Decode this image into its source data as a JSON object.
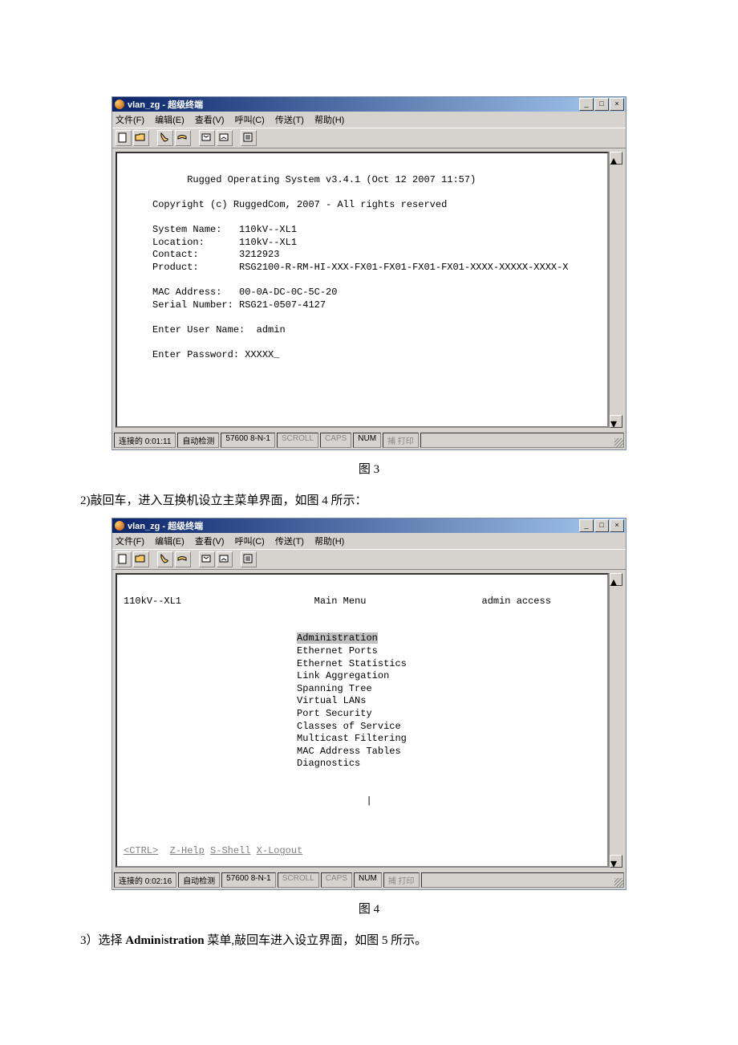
{
  "window1": {
    "title": "vlan_zg - 超级终端",
    "menu": {
      "file": "文件(F)",
      "edit": "编辑(E)",
      "view": "查看(V)",
      "call": "呼叫(C)",
      "transfer": "传送(T)",
      "help": "帮助(H)"
    },
    "terminal": {
      "line1": "           Rugged Operating System v3.4.1 (Oct 12 2007 11:57)",
      "line2": "     Copyright (c) RuggedCom, 2007 - All rights reserved",
      "sysname_lbl": "     System Name:",
      "sysname_val": "   110kV--XL1",
      "location_lbl": "     Location:",
      "location_val": "      110kV--XL1",
      "contact_lbl": "     Contact:",
      "contact_val": "       3212923",
      "product_lbl": "     Product:",
      "product_val": "       RSG2100-R-RM-HI-XXX-FX01-FX01-FX01-FX01-XXXX-XXXXX-XXXX-X",
      "mac_lbl": "     MAC Address:",
      "mac_val": "   00-0A-DC-0C-5C-20",
      "serial_lbl": "     Serial Number:",
      "serial_val": " RSG21-0507-4127",
      "user_lbl": "     Enter User Name:",
      "user_val": "  admin",
      "pass_lbl": "     Enter Password:",
      "pass_val": " XXXXX_"
    },
    "status": {
      "conn": "连接的 0:01:11",
      "auto": "自动检测",
      "baud": "57600 8-N-1",
      "scroll": "SCROLL",
      "caps": "CAPS",
      "num": "NUM",
      "rec": "捕   打印"
    }
  },
  "window2": {
    "title": "vlan_zg - 超级终端",
    "terminal": {
      "header_left": "110kV--XL1",
      "header_mid": "Main Menu",
      "header_right": "admin access",
      "menu_items": [
        "Administration",
        "Ethernet Ports",
        "Ethernet Statistics",
        "Link Aggregation",
        "Spanning Tree",
        "Virtual LANs",
        "Port Security",
        "Classes of Service",
        "Multicast Filtering",
        "MAC Address Tables",
        "Diagnostics"
      ],
      "footer_ctrl": "<CTRL>",
      "footer_z": "Z-Help",
      "footer_s": "S-Shell",
      "footer_x": "X-Logout"
    },
    "status": {
      "conn": "连接的 0:02:16",
      "auto": "自动检测",
      "baud": "57600 8-N-1",
      "scroll": "SCROLL",
      "caps": "CAPS",
      "num": "NUM",
      "rec": "捕   打印"
    }
  },
  "captions": {
    "fig3": "图 3",
    "fig4": "图 4"
  },
  "doc": {
    "para2": "2)敲回车，进入互换机设立主菜单界面，如图 4 所示：",
    "para3_prefix": "3）选择 ",
    "para3_bold1": "Admin",
    "para3_mid": "ⅰ",
    "para3_bold2": "stration",
    "para3_suffix": " 菜单,敲回车进入设立界面，如图 5 所示。"
  },
  "win_btns": {
    "min": "_",
    "max": "□",
    "close": "×"
  }
}
